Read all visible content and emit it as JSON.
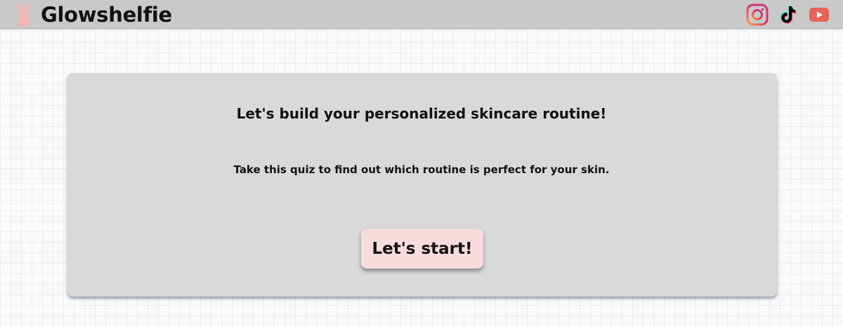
{
  "header": {
    "brand": "Glowshelfie",
    "logo_icon": "bunny-logo-icon",
    "social": [
      {
        "name": "instagram-icon",
        "color": "#e1306c"
      },
      {
        "name": "tiktok-icon",
        "color": "#000000"
      },
      {
        "name": "youtube-icon",
        "color": "#e8635a"
      }
    ]
  },
  "card": {
    "title": "Let's build your personalized skincare routine!",
    "subtitle": "Take this quiz to find out which routine is perfect for your skin.",
    "start_label": "Let's start!"
  },
  "colors": {
    "header_bg": "#c9c9c9",
    "card_bg": "#d9d9d9",
    "button_bg": "#f6dcdc",
    "logo_pink": "#f1b7b4"
  }
}
